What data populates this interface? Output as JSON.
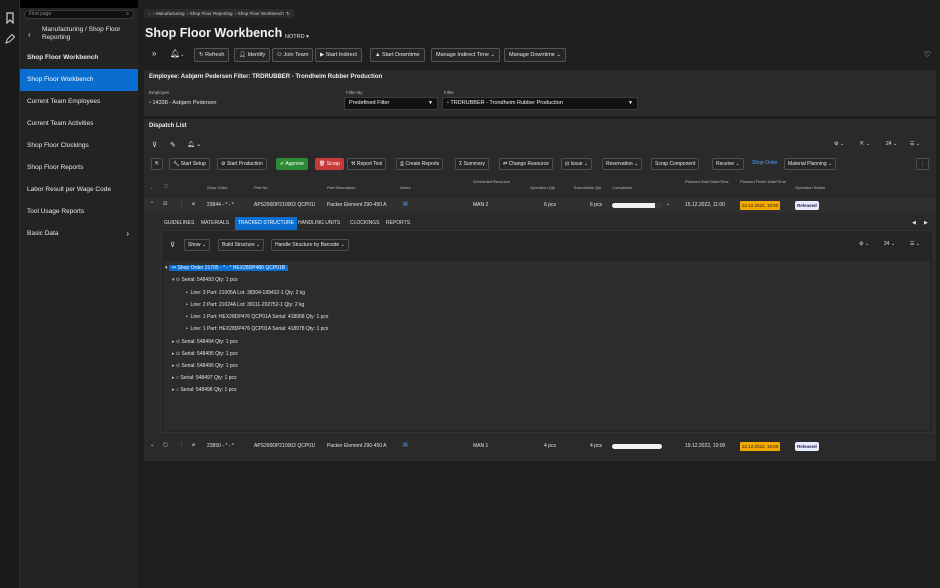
{
  "nav": {
    "search_placeholder": "Find page",
    "header": "Manufacturing / Shop Floor Reporting",
    "items": [
      {
        "label": "Shop Floor Workbench"
      },
      {
        "label": "Shop Floor Workbench"
      },
      {
        "label": "Current Team Employees"
      },
      {
        "label": "Current Team Activities"
      },
      {
        "label": "Shop Floor Clockings"
      },
      {
        "label": "Shop Floor Reports"
      },
      {
        "label": "Labor Result per Wage Code"
      },
      {
        "label": "Tool Usage Reports"
      },
      {
        "label": "Basic Data"
      }
    ]
  },
  "breadcrumb": {
    "root": "Manufacturing",
    "mid": "Shop Floor Reporting",
    "current": "Shop Floor Workbench"
  },
  "page": {
    "title": "Shop Floor Workbench",
    "variant": "NOTRD"
  },
  "toolbar": [
    "Refresh",
    "Identify",
    "Join Team",
    "Start Indirect",
    "Start Downtime",
    "Manage Indirect Time",
    "Manage Downtime"
  ],
  "employee_panel": {
    "header": "Employee: Asbjørn Pedersen Filter: TRDRUBBER - Trondheim Rubber Production",
    "employee_label": "Employee",
    "employee_value": "14338 - Asbjørn Pedersen",
    "filter_by_label": "Filter By",
    "filter_by_value": "Predefined Filter",
    "filter_label": "Filter",
    "filter_value": "TRDRUBBER - Trondheim Rubber Production"
  },
  "dispatch": {
    "title": "Dispatch List",
    "page_size": "24",
    "actions": [
      "Start Setup",
      "Start Production",
      "Approve",
      "Scrap",
      "Report Tool",
      "Create Reports",
      "Summary",
      "Change Resource",
      "Issue",
      "Reservation",
      "Scrap Component",
      "Receive",
      "Shop Order",
      "Material Planning"
    ],
    "columns": {
      "shop_order": "Shop Order",
      "part_no": "Part No",
      "part_desc": "Part Description",
      "notes": "Notes",
      "resource": "Scheduled Resource",
      "op_qty": "Operation Qty",
      "exec_qty": "Executable Qty",
      "completion": "Completion",
      "start": "Planned Start Date/Time",
      "finish": "Planned Finish Date/Time",
      "status": "Operation Status"
    },
    "rows": [
      {
        "shop_order": "23844 - * - *",
        "part_no": "APS290DP210002 QCP01/",
        "part_desc": "Packer Element 290-450 A",
        "resource": "MAN 2",
        "op_qty": "6 pcs",
        "exec_qty": "6 pcs",
        "completion": 0.85,
        "start": "15.12.2022, 11:00",
        "finish": "22.12.2022, 10:00",
        "status": "Released"
      },
      {
        "shop_order": "23850 - * - *",
        "part_no": "APS290DP210002 QCP01/",
        "part_desc": "Packer Element 290-450 A",
        "resource": "MAN 1",
        "op_qty": "4 pcs",
        "exec_qty": "4 pcs",
        "completion": 1.0,
        "start": "19.12.2022, 10:00",
        "finish": "22.12.2022, 16:00",
        "status": "Released"
      }
    ]
  },
  "detail": {
    "tabs": [
      "GUIDELINES",
      "MATERIALS",
      "TRACKED STRUCTURE",
      "HANDLING UNITS",
      "CLOCKINGS",
      "REPORTS"
    ],
    "tools": [
      "Show",
      "Build Structure",
      "Handle Structure by Barcode"
    ],
    "page_size": "24",
    "tree": [
      "Shop Order 21705 - * - *  HEX28DP480 QCP01B",
      "Serial: 548493 Qty: 1 pcs",
      "Line: 3 Part: 21005A Lot: 38304-199432-1 Qty: 2 kg",
      "Line: 2 Part: 21024A Lot: 39111-202752-1 Qty: 2 kg",
      "Line: 1 Part: HEX28DP476 QCP01A Serial: 418968 Qty: 1 pcs",
      "Line: 1 Part: HEX28DP476 QCP01A Serial: 418978 Qty: 1 pcs",
      "Serial: 548494 Qty: 1 pcs",
      "Serial: 548495 Qty: 1 pcs",
      "Serial: 548496 Qty: 1 pcs",
      "Serial: 548497 Qty: 1 pcs",
      "Serial: 548498 Qty: 1 pcs"
    ]
  },
  "colors": {
    "accent": "#0a6ed1",
    "approve": "#2c8a34",
    "scrap": "#c73a3a",
    "date_warn": "#f2a900"
  }
}
